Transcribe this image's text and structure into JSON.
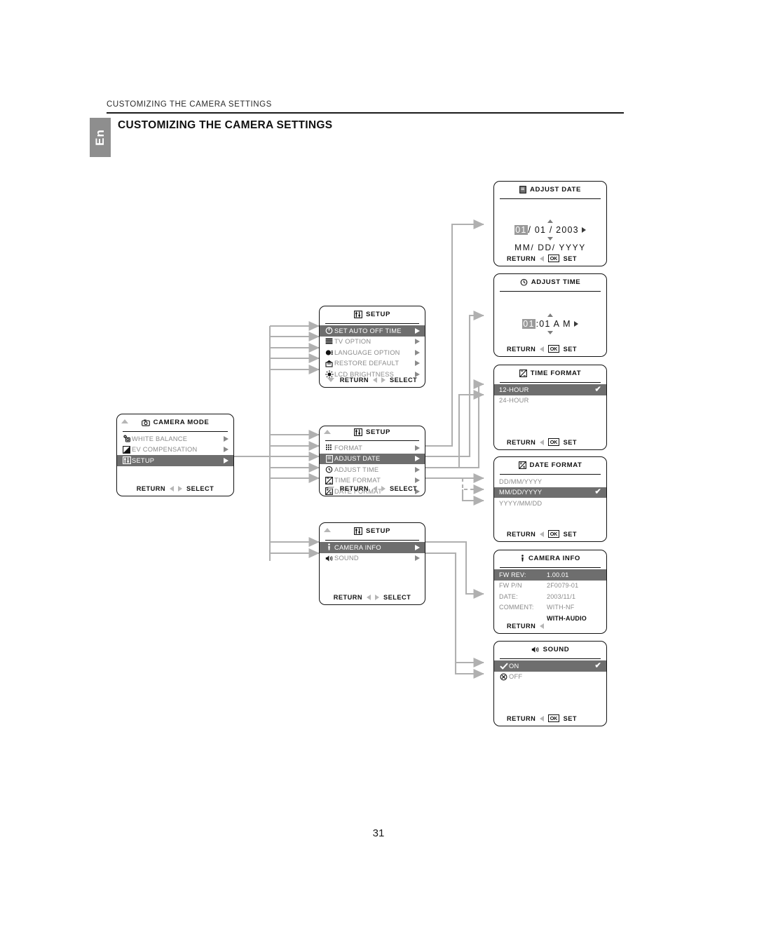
{
  "header": {
    "running_head": "CUSTOMIZING THE CAMERA SETTINGS",
    "lang_tab": "En",
    "title": "CUSTOMIZING THE CAMERA SETTINGS",
    "folio": "31"
  },
  "common": {
    "return_label": "RETURN",
    "select_label": "SELECT",
    "set_label": "SET",
    "ok_label": "OK"
  },
  "panels": {
    "camera_mode": {
      "title": "CAMERA MODE",
      "title_icon": "camera-icon",
      "items": [
        {
          "label": "WHITE BALANCE",
          "icon": "white-balance-icon",
          "selected": false,
          "caret": true
        },
        {
          "label": "EV COMPENSATION",
          "icon": "ev-compensation-icon",
          "selected": false,
          "caret": true
        },
        {
          "label": "SETUP",
          "icon": "setup-icon",
          "selected": true,
          "caret": true
        }
      ]
    },
    "setup_general": {
      "title": "SETUP",
      "title_icon": "setup-icon",
      "items": [
        {
          "label": "SET AUTO OFF TIME",
          "icon": "power-icon",
          "selected": true,
          "caret": true
        },
        {
          "label": "TV OPTION",
          "icon": "tv-icon",
          "selected": false,
          "caret": true
        },
        {
          "label": "LANGUAGE OPTION",
          "icon": "language-icon",
          "selected": false,
          "caret": true
        },
        {
          "label": "RESTORE DEFAULT",
          "icon": "restore-icon",
          "selected": false,
          "caret": true
        },
        {
          "label": "LCD BRIGHTNESS",
          "icon": "brightness-icon",
          "selected": false,
          "caret": true
        }
      ]
    },
    "setup_datetime": {
      "title": "SETUP",
      "title_icon": "setup-icon",
      "items": [
        {
          "label": "FORMAT",
          "icon": "format-icon",
          "selected": false,
          "caret": true
        },
        {
          "label": "ADJUST DATE",
          "icon": "calendar-icon",
          "selected": true,
          "caret": true
        },
        {
          "label": "ADJUST TIME",
          "icon": "clock-icon",
          "selected": false,
          "caret": true
        },
        {
          "label": "TIME FORMAT",
          "icon": "time-format-icon",
          "selected": false,
          "caret": true
        },
        {
          "label": "DATE FORMAT",
          "icon": "date-format-icon",
          "selected": false,
          "caret": true
        }
      ]
    },
    "setup_info": {
      "title": "SETUP",
      "title_icon": "setup-icon",
      "items": [
        {
          "label": "CAMERA INFO",
          "icon": "info-icon",
          "selected": true,
          "caret": true
        },
        {
          "label": "SOUND",
          "icon": "speaker-icon",
          "selected": false,
          "caret": true
        }
      ]
    },
    "adjust_date": {
      "title": "ADJUST DATE",
      "title_icon": "calendar-icon",
      "value_month": "01",
      "value_rest": "/ 01 / 2003",
      "format_hint": "MM/ DD/ YYYY"
    },
    "adjust_time": {
      "title": "ADJUST TIME",
      "title_icon": "clock-icon",
      "value_hour": "01",
      "value_rest": ":01 A M"
    },
    "time_format": {
      "title": "TIME FORMAT",
      "title_icon": "time-format-icon",
      "options": [
        {
          "label": "12-HOUR",
          "selected": true,
          "checked": true
        },
        {
          "label": "24-HOUR",
          "selected": false,
          "checked": false
        }
      ]
    },
    "date_format": {
      "title": "DATE FORMAT",
      "title_icon": "date-format-icon",
      "options": [
        {
          "label": "DD/MM/YYYY",
          "selected": false,
          "checked": false
        },
        {
          "label": "MM/DD/YYYY",
          "selected": true,
          "checked": true
        },
        {
          "label": "YYYY/MM/DD",
          "selected": false,
          "checked": false
        }
      ]
    },
    "camera_info": {
      "title": "CAMERA INFO",
      "title_icon": "info-icon",
      "rows": [
        {
          "key": "FW REV:",
          "value": "1.00.01",
          "selected": true,
          "bold": false
        },
        {
          "key": "FW P/N",
          "value": "2F0079-01",
          "selected": false,
          "bold": false
        },
        {
          "key": "DATE:",
          "value": "2003/11/1",
          "selected": false,
          "bold": false
        },
        {
          "key": "COMMENT:",
          "value": "WITH-NF",
          "selected": false,
          "bold": false
        },
        {
          "key": "",
          "value": "WITH-AUDIO",
          "selected": false,
          "bold": true
        }
      ]
    },
    "sound": {
      "title": "SOUND",
      "title_icon": "speaker-icon",
      "options": [
        {
          "label": "ON",
          "icon": "check-icon",
          "selected": true,
          "checked": true
        },
        {
          "label": "OFF",
          "icon": "mute-icon",
          "selected": false,
          "checked": false
        }
      ]
    }
  }
}
